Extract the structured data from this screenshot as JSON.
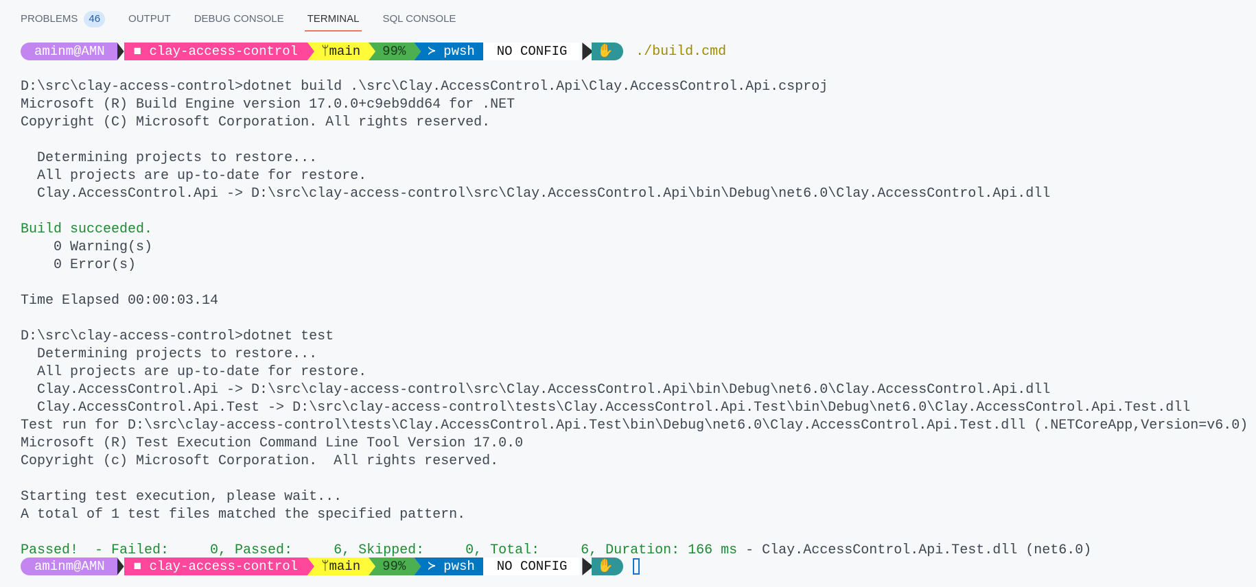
{
  "tabs": [
    {
      "label": "PROBLEMS",
      "badge": "46"
    },
    {
      "label": "OUTPUT"
    },
    {
      "label": "DEBUG CONSOLE"
    },
    {
      "label": "TERMINAL",
      "active": true
    },
    {
      "label": "SQL CONSOLE"
    }
  ],
  "prompt": {
    "user": "aminm@AMN",
    "folder_icon": "■",
    "path": "clay-access-control",
    "branch_icon": "ᛘ",
    "branch": "main",
    "battery": "99%",
    "shell_icon": "≻",
    "shell": "pwsh",
    "config": "NO CONFIG",
    "hand_icon": "✋"
  },
  "first_command": "./build.cmd",
  "output": [
    "D:\\src\\clay-access-control>dotnet build .\\src\\Clay.AccessControl.Api\\Clay.AccessControl.Api.csproj",
    "Microsoft (R) Build Engine version 17.0.0+c9eb9dd64 for .NET",
    "Copyright (C) Microsoft Corporation. All rights reserved.",
    "",
    "  Determining projects to restore...",
    "  All projects are up-to-date for restore.",
    "  Clay.AccessControl.Api -> D:\\src\\clay-access-control\\src\\Clay.AccessControl.Api\\bin\\Debug\\net6.0\\Clay.AccessControl.Api.dll",
    "",
    "Build succeeded.",
    "    0 Warning(s)",
    "    0 Error(s)",
    "",
    "Time Elapsed 00:00:03.14",
    "",
    "D:\\src\\clay-access-control>dotnet test",
    "  Determining projects to restore...",
    "  All projects are up-to-date for restore.",
    "  Clay.AccessControl.Api -> D:\\src\\clay-access-control\\src\\Clay.AccessControl.Api\\bin\\Debug\\net6.0\\Clay.AccessControl.Api.dll",
    "  Clay.AccessControl.Api.Test -> D:\\src\\clay-access-control\\tests\\Clay.AccessControl.Api.Test\\bin\\Debug\\net6.0\\Clay.AccessControl.Api.Test.dll",
    "Test run for D:\\src\\clay-access-control\\tests\\Clay.AccessControl.Api.Test\\bin\\Debug\\net6.0\\Clay.AccessControl.Api.Test.dll (.NETCoreApp,Version=v6.0)",
    "Microsoft (R) Test Execution Command Line Tool Version 17.0.0",
    "Copyright (c) Microsoft Corporation.  All rights reserved.",
    "",
    "Starting test execution, please wait...",
    "A total of 1 test files matched the specified pattern.",
    ""
  ],
  "green_lines": [
    8
  ],
  "summary": {
    "green": "Passed!  - Failed:     0, Passed:     6, Skipped:     0, Total:     6, Duration: 166 ms",
    "rest": " - Clay.AccessControl.Api.Test.dll (net6.0)"
  }
}
